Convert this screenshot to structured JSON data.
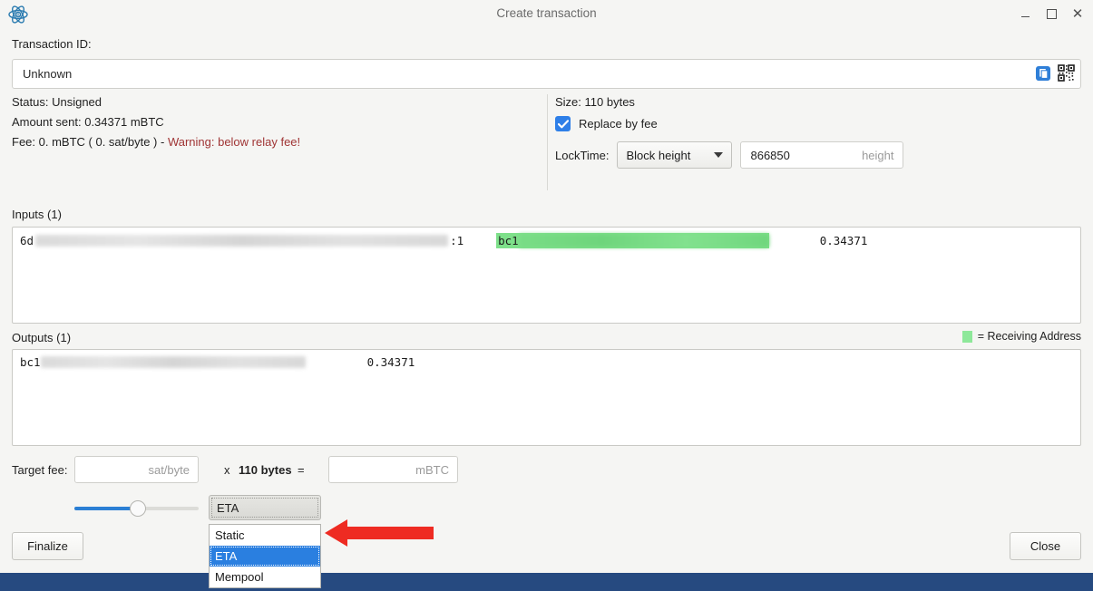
{
  "window": {
    "title": "Create transaction",
    "app_icon": "electrum-atom-icon",
    "controls": {
      "minimize": "minimize",
      "maximize": "maximize",
      "close": "close"
    }
  },
  "txid": {
    "label": "Transaction ID:",
    "value": "Unknown",
    "copy_icon": "copy-icon",
    "qr_icon": "qr-code-icon"
  },
  "summary": {
    "status": "Status: Unsigned",
    "amount_sent": "Amount sent: 0.34371 mBTC",
    "fee_prefix": "Fee: 0. mBTC ( 0. sat/byte ) - ",
    "fee_warning": "Warning: below relay fee!",
    "warning_color": "#a03535"
  },
  "details": {
    "size": "Size: 110 bytes",
    "rbf_label": "Replace by fee",
    "rbf_checked": true,
    "locktime_label": "LockTime:",
    "locktime_mode": "Block height",
    "locktime_options": [
      "Block height"
    ],
    "locktime_value": "866850",
    "locktime_placeholder": "height",
    "checkbox_color": "#2e7fe8"
  },
  "inputs": {
    "heading": "Inputs (1)",
    "rows": [
      {
        "txid_prefix": "6d",
        "txid_blur_width": 455,
        "vout": ":1",
        "address_prefix": "bc1",
        "address_blur_width": 276,
        "address_highlight": "#7ee08a",
        "amount": "0.34371"
      }
    ]
  },
  "outputs": {
    "heading": "Outputs (1)",
    "legend_text": "= Receiving Address",
    "legend_color": "#8ee89a",
    "rows": [
      {
        "address_prefix": "bc1",
        "address_blur_width": 292,
        "amount": "0.34371"
      }
    ]
  },
  "fee": {
    "target_label": "Target fee:",
    "rate_value": "",
    "rate_placeholder": "sat/byte",
    "multiply": "x",
    "size_bytes": "110 bytes",
    "equals": "=",
    "total_value": "",
    "total_placeholder": "mBTC",
    "slider_percent": 48,
    "method_selected": "ETA",
    "method_options": [
      "Static",
      "ETA",
      "Mempool"
    ],
    "method_highlight": "#2a7fe0"
  },
  "annotation": {
    "arrow": "red-left-arrow",
    "arrow_color": "#ee2b22"
  },
  "footer": {
    "finalize_label": "Finalize",
    "close_label": "Close"
  },
  "taskbar": {
    "color": "#264a80"
  }
}
